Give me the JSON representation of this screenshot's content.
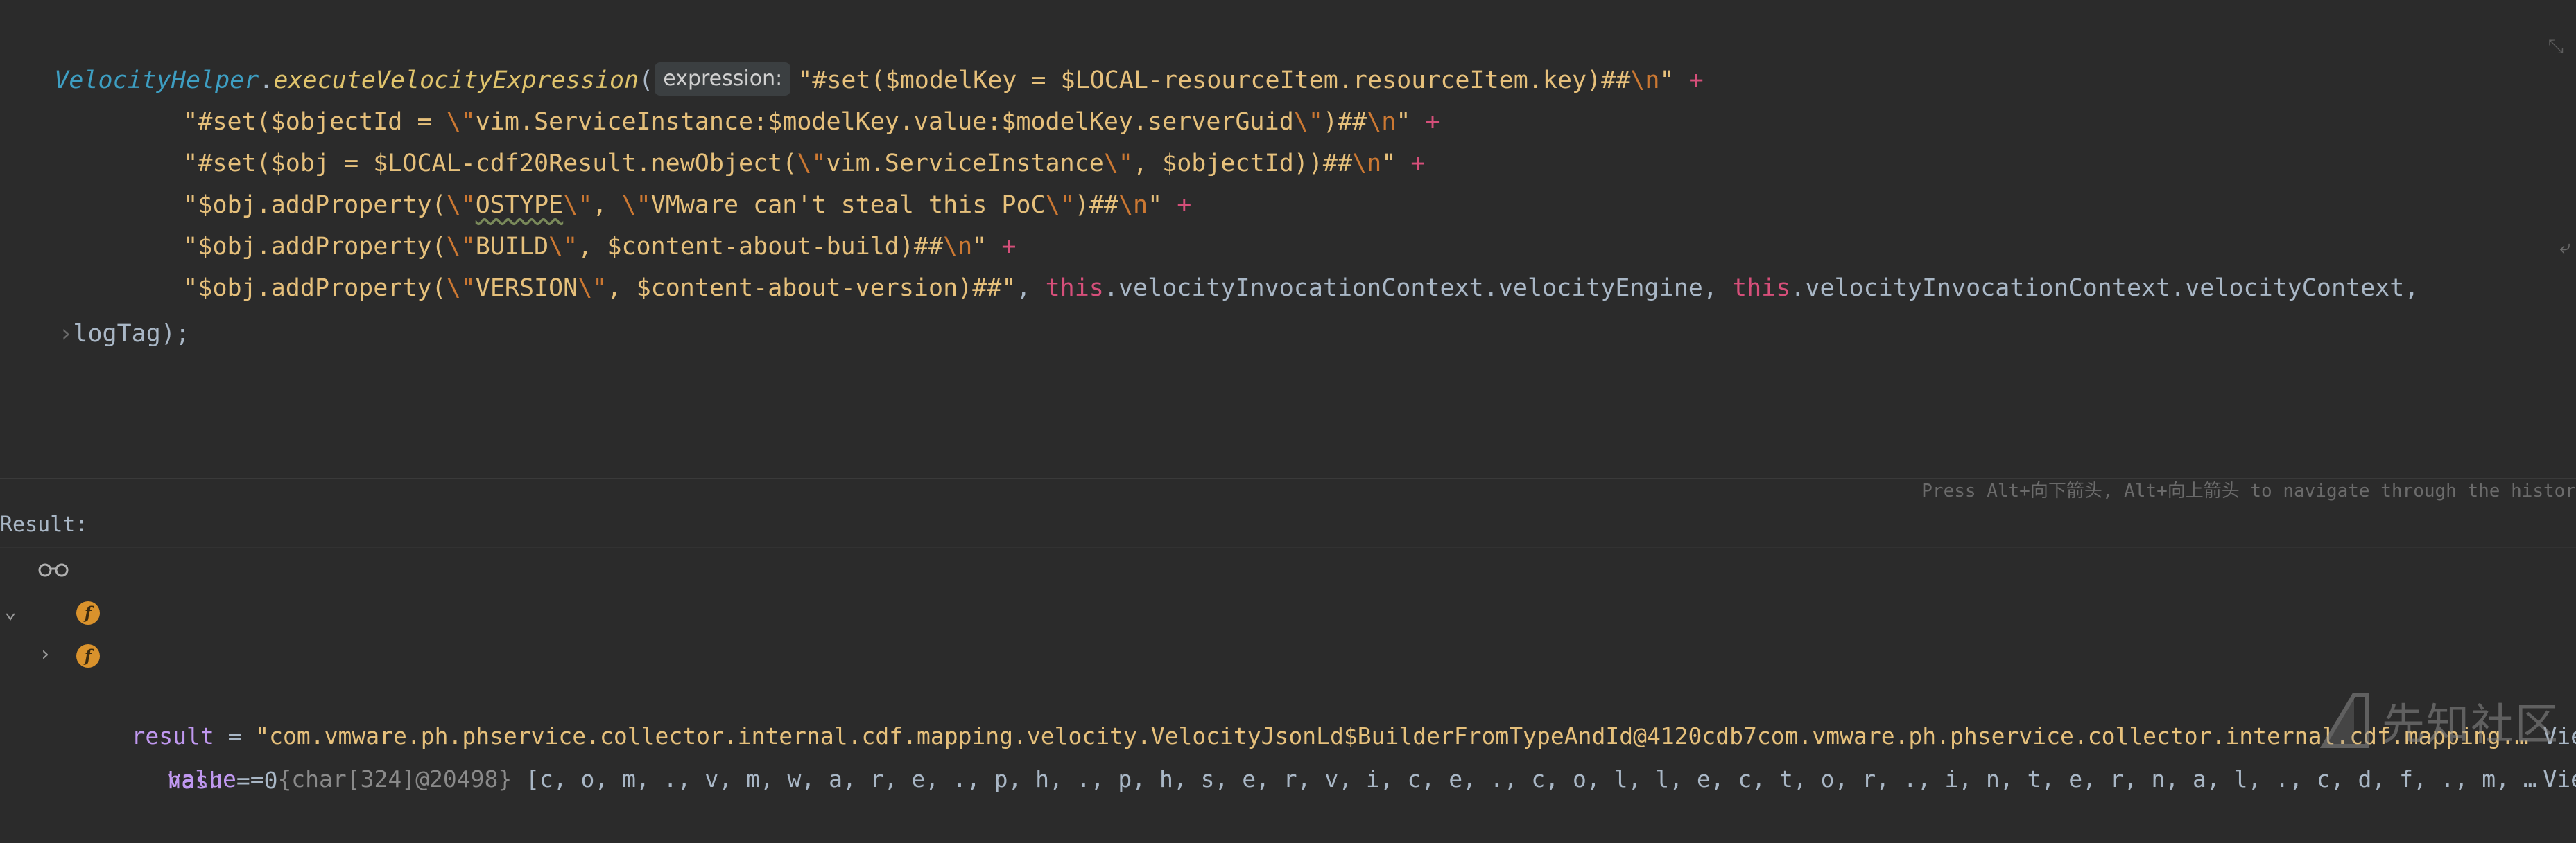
{
  "editor": {
    "line1": {
      "class": "VelocityHelper",
      "dot": ".",
      "method": "executeVelocityExpression",
      "paren": "(",
      "hint": "expression:",
      "str": "\"#set($modelKey = $LOCAL-resourceItem.resourceItem.key)##",
      "esc": "\\n",
      "strend": "\"",
      "plus": " +"
    },
    "line2": {
      "str": "\"#set($objectId = ",
      "esc1": "\\\"",
      "mid": "vim.ServiceInstance:$modelKey.value:$modelKey.serverGuid",
      "esc2": "\\\"",
      "tail": ")##",
      "esc3": "\\n",
      "strend": "\"",
      "plus": " +"
    },
    "line3": {
      "str": "\"#set($obj = $LOCAL-cdf20Result.newObject(",
      "esc1": "\\\"",
      "mid": "vim.ServiceInstance",
      "esc2": "\\\"",
      "tail": ", $objectId))##",
      "esc3": "\\n",
      "strend": "\"",
      "plus": " +"
    },
    "line4": {
      "str": "\"$obj.addProperty(",
      "esc1": "\\\"",
      "wavy": "OSTYPE",
      "esc2": "\\\"",
      "mid": ", ",
      "esc3": "\\\"",
      "mid2": "VMware can't steal this PoC",
      "esc4": "\\\"",
      "tail": ")##",
      "esc5": "\\n",
      "strend": "\"",
      "plus": " +"
    },
    "line5": {
      "str": "\"$obj.addProperty(",
      "esc1": "\\\"",
      "mid": "BUILD",
      "esc2": "\\\"",
      "tail": ", $content-about-build)##",
      "esc3": "\\n",
      "strend": "\"",
      "plus": " +"
    },
    "line6": {
      "str": "\"$obj.addProperty(",
      "esc1": "\\\"",
      "mid": "VERSION",
      "esc2": "\\\"",
      "tail": ", $content-about-version)##\"",
      "comma": ", ",
      "this1": "this",
      "field1": ".velocityInvocationContext.velocityEngine",
      "comma2": ", ",
      "this2": "this",
      "field2": ".velocityInvocationContext.velocityContext",
      "comma3": ","
    },
    "line7": {
      "text": "logTag",
      "tail": ");"
    },
    "navigation_hint": "Press Alt+向下箭头, Alt+向上箭头 to navigate through the histor"
  },
  "result": {
    "label": "Result:",
    "root": {
      "name": "result",
      "eq": " = ",
      "value": "\"com.vmware.ph.phservice.collector.internal.cdf.mapping.velocity.VelocityJsonLd$BuilderFromTypeAndId@4120cdb7com.vmware.ph.phservice.collector.internal.cdf.mapping.…",
      "view": "Vie"
    },
    "children": [
      {
        "icon": "f",
        "name": "value",
        "eq": " = ",
        "type": "{char[324]@20498}",
        "value": " [c, o, m, ., v, m, w, a, r, e, ., p, h, ., p, h, s, e, r, v, i, c, e, ., c, o, l, l, e, c, t, o, r, ., i, n, t, e, r, n, a, l, ., c, d, f, ., m, …",
        "view": "Vie"
      },
      {
        "icon": "f",
        "name": "hash",
        "eq": " = ",
        "value": "0"
      }
    ]
  },
  "watermark": {
    "text": "先知社区"
  }
}
